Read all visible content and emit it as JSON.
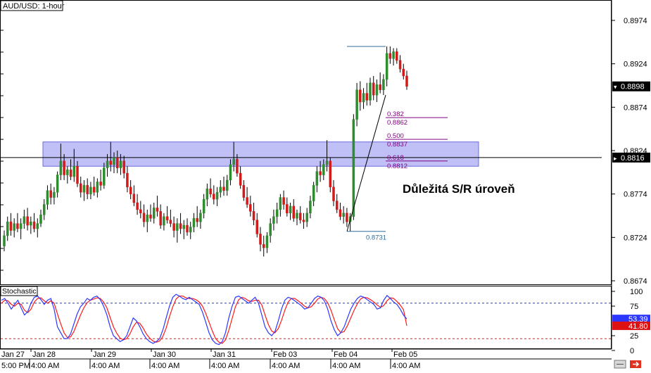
{
  "window": {
    "title": "AUD/USD: 1-hour",
    "indicator_label": "Stochastic",
    "annotation": "Důležitá S/R úroveň"
  },
  "colors": {
    "bull": "#2e8b2e",
    "bear": "#d11a1a",
    "zone": "#8c8cf0",
    "fib": "#800080",
    "swing": "#2f6b9a",
    "k_line": "#2b36ff",
    "d_line": "#ff1a1a",
    "ob": "#1f3fbf",
    "os": "#e02020"
  },
  "chart_data": [
    {
      "type": "candlestick",
      "title": "AUD/USD: 1-hour",
      "ylim": [
        0.8654,
        0.9
      ],
      "y_ticks": [
        "0.8974",
        "0.8924",
        "0.8874",
        "0.8824",
        "0.8774",
        "0.8724",
        "0.8674"
      ],
      "x_date_labels": [
        "Jan 27",
        "Jan 28",
        "Jan 29",
        "Jan 30",
        "Jan 31",
        "Feb 03",
        "Feb 04",
        "Feb 05"
      ],
      "x_time_labels": [
        "5:00 PM",
        "4:00 AM",
        "4:00 AM",
        "4:00 AM",
        "4:00 AM",
        "4:00 AM",
        "4:00 AM",
        "4:00 AM"
      ],
      "current_price": "0.8898",
      "hline_price": "0.8816",
      "support_resistance_zone": [
        0.8806,
        0.8834
      ],
      "fibonacci": {
        "swing_low": "0.8731",
        "swing_high": 0.8944,
        "levels": [
          {
            "ratio": "0.382",
            "price": "0.8862"
          },
          {
            "ratio": "0.500",
            "price": "0.8837"
          },
          {
            "ratio": "0.618",
            "price": "0.8812"
          }
        ]
      },
      "ohlc": [
        {
          "o": 0.8714,
          "h": 0.8732,
          "l": 0.8708,
          "c": 0.8726
        },
        {
          "o": 0.8726,
          "h": 0.8748,
          "l": 0.872,
          "c": 0.8742
        },
        {
          "o": 0.8742,
          "h": 0.8752,
          "l": 0.8726,
          "c": 0.8732
        },
        {
          "o": 0.8732,
          "h": 0.8746,
          "l": 0.8724,
          "c": 0.874
        },
        {
          "o": 0.874,
          "h": 0.8752,
          "l": 0.873,
          "c": 0.8734
        },
        {
          "o": 0.8734,
          "h": 0.8746,
          "l": 0.8722,
          "c": 0.874
        },
        {
          "o": 0.874,
          "h": 0.8756,
          "l": 0.8734,
          "c": 0.8748
        },
        {
          "o": 0.8748,
          "h": 0.8758,
          "l": 0.8732,
          "c": 0.8738
        },
        {
          "o": 0.8738,
          "h": 0.8748,
          "l": 0.8728,
          "c": 0.8742
        },
        {
          "o": 0.8742,
          "h": 0.8752,
          "l": 0.873,
          "c": 0.8734
        },
        {
          "o": 0.8734,
          "h": 0.8746,
          "l": 0.8724,
          "c": 0.874
        },
        {
          "o": 0.874,
          "h": 0.8756,
          "l": 0.8736,
          "c": 0.875
        },
        {
          "o": 0.875,
          "h": 0.8768,
          "l": 0.8744,
          "c": 0.8762
        },
        {
          "o": 0.8762,
          "h": 0.8784,
          "l": 0.8756,
          "c": 0.8778
        },
        {
          "o": 0.8778,
          "h": 0.8786,
          "l": 0.8762,
          "c": 0.877
        },
        {
          "o": 0.877,
          "h": 0.8782,
          "l": 0.8762,
          "c": 0.8776
        },
        {
          "o": 0.8776,
          "h": 0.88,
          "l": 0.877,
          "c": 0.8796
        },
        {
          "o": 0.8796,
          "h": 0.8832,
          "l": 0.879,
          "c": 0.8812
        },
        {
          "o": 0.8812,
          "h": 0.882,
          "l": 0.879,
          "c": 0.8796
        },
        {
          "o": 0.8796,
          "h": 0.8806,
          "l": 0.8786,
          "c": 0.8802
        },
        {
          "o": 0.8802,
          "h": 0.8814,
          "l": 0.879,
          "c": 0.8794
        },
        {
          "o": 0.8794,
          "h": 0.8826,
          "l": 0.8788,
          "c": 0.8806
        },
        {
          "o": 0.8806,
          "h": 0.8812,
          "l": 0.8782,
          "c": 0.8786
        },
        {
          "o": 0.8786,
          "h": 0.8794,
          "l": 0.877,
          "c": 0.8776
        },
        {
          "o": 0.8776,
          "h": 0.879,
          "l": 0.8766,
          "c": 0.8784
        },
        {
          "o": 0.8784,
          "h": 0.8792,
          "l": 0.8768,
          "c": 0.8774
        },
        {
          "o": 0.8774,
          "h": 0.8788,
          "l": 0.8768,
          "c": 0.8782
        },
        {
          "o": 0.8782,
          "h": 0.8794,
          "l": 0.8772,
          "c": 0.8776
        },
        {
          "o": 0.8776,
          "h": 0.8792,
          "l": 0.877,
          "c": 0.8788
        },
        {
          "o": 0.8788,
          "h": 0.8802,
          "l": 0.8778,
          "c": 0.8784
        },
        {
          "o": 0.8784,
          "h": 0.881,
          "l": 0.878,
          "c": 0.8804
        },
        {
          "o": 0.8804,
          "h": 0.882,
          "l": 0.8794,
          "c": 0.8812
        },
        {
          "o": 0.8812,
          "h": 0.8834,
          "l": 0.88,
          "c": 0.8808
        },
        {
          "o": 0.8808,
          "h": 0.8822,
          "l": 0.8798,
          "c": 0.8816
        },
        {
          "o": 0.8816,
          "h": 0.8824,
          "l": 0.8798,
          "c": 0.8804
        },
        {
          "o": 0.8804,
          "h": 0.882,
          "l": 0.8796,
          "c": 0.8812
        },
        {
          "o": 0.8812,
          "h": 0.8818,
          "l": 0.8792,
          "c": 0.8798
        },
        {
          "o": 0.8798,
          "h": 0.8806,
          "l": 0.8776,
          "c": 0.8782
        },
        {
          "o": 0.8782,
          "h": 0.879,
          "l": 0.8768,
          "c": 0.8774
        },
        {
          "o": 0.8774,
          "h": 0.8784,
          "l": 0.876,
          "c": 0.8764
        },
        {
          "o": 0.8764,
          "h": 0.8774,
          "l": 0.875,
          "c": 0.8756
        },
        {
          "o": 0.8756,
          "h": 0.8766,
          "l": 0.8746,
          "c": 0.8752
        },
        {
          "o": 0.8752,
          "h": 0.8762,
          "l": 0.8736,
          "c": 0.8742
        },
        {
          "o": 0.8742,
          "h": 0.8756,
          "l": 0.873,
          "c": 0.875
        },
        {
          "o": 0.875,
          "h": 0.8762,
          "l": 0.8742,
          "c": 0.8746
        },
        {
          "o": 0.8746,
          "h": 0.8764,
          "l": 0.874,
          "c": 0.8758
        },
        {
          "o": 0.8758,
          "h": 0.8772,
          "l": 0.8748,
          "c": 0.8754
        },
        {
          "o": 0.8754,
          "h": 0.8762,
          "l": 0.8734,
          "c": 0.8738
        },
        {
          "o": 0.8738,
          "h": 0.8752,
          "l": 0.8732,
          "c": 0.8748
        },
        {
          "o": 0.8748,
          "h": 0.876,
          "l": 0.874,
          "c": 0.8744
        },
        {
          "o": 0.8744,
          "h": 0.8756,
          "l": 0.8736,
          "c": 0.874
        },
        {
          "o": 0.874,
          "h": 0.8748,
          "l": 0.8724,
          "c": 0.8732
        },
        {
          "o": 0.8732,
          "h": 0.8746,
          "l": 0.8718,
          "c": 0.874
        },
        {
          "o": 0.874,
          "h": 0.8752,
          "l": 0.8728,
          "c": 0.8734
        },
        {
          "o": 0.8734,
          "h": 0.8744,
          "l": 0.8722,
          "c": 0.8738
        },
        {
          "o": 0.8738,
          "h": 0.8746,
          "l": 0.8726,
          "c": 0.873
        },
        {
          "o": 0.873,
          "h": 0.8742,
          "l": 0.8722,
          "c": 0.8736
        },
        {
          "o": 0.8736,
          "h": 0.8752,
          "l": 0.873,
          "c": 0.8746
        },
        {
          "o": 0.8746,
          "h": 0.876,
          "l": 0.8736,
          "c": 0.8742
        },
        {
          "o": 0.8742,
          "h": 0.8756,
          "l": 0.8734,
          "c": 0.8752
        },
        {
          "o": 0.8752,
          "h": 0.8774,
          "l": 0.8746,
          "c": 0.8768
        },
        {
          "o": 0.8768,
          "h": 0.8786,
          "l": 0.876,
          "c": 0.878
        },
        {
          "o": 0.878,
          "h": 0.8792,
          "l": 0.877,
          "c": 0.8774
        },
        {
          "o": 0.8774,
          "h": 0.8784,
          "l": 0.8762,
          "c": 0.8768
        },
        {
          "o": 0.8768,
          "h": 0.8782,
          "l": 0.876,
          "c": 0.8776
        },
        {
          "o": 0.8776,
          "h": 0.879,
          "l": 0.877,
          "c": 0.8782
        },
        {
          "o": 0.8782,
          "h": 0.8794,
          "l": 0.8772,
          "c": 0.8778
        },
        {
          "o": 0.8778,
          "h": 0.8796,
          "l": 0.8772,
          "c": 0.879
        },
        {
          "o": 0.879,
          "h": 0.8814,
          "l": 0.8784,
          "c": 0.8808
        },
        {
          "o": 0.8808,
          "h": 0.8834,
          "l": 0.88,
          "c": 0.8814
        },
        {
          "o": 0.8814,
          "h": 0.882,
          "l": 0.8794,
          "c": 0.8798
        },
        {
          "o": 0.8798,
          "h": 0.8806,
          "l": 0.878,
          "c": 0.8784
        },
        {
          "o": 0.8784,
          "h": 0.879,
          "l": 0.8766,
          "c": 0.877
        },
        {
          "o": 0.877,
          "h": 0.8782,
          "l": 0.8758,
          "c": 0.8762
        },
        {
          "o": 0.8762,
          "h": 0.8772,
          "l": 0.8748,
          "c": 0.8754
        },
        {
          "o": 0.8754,
          "h": 0.8764,
          "l": 0.8738,
          "c": 0.8744
        },
        {
          "o": 0.8744,
          "h": 0.8752,
          "l": 0.8724,
          "c": 0.8728
        },
        {
          "o": 0.8728,
          "h": 0.8736,
          "l": 0.8708,
          "c": 0.8716
        },
        {
          "o": 0.8716,
          "h": 0.8726,
          "l": 0.8702,
          "c": 0.8712
        },
        {
          "o": 0.8712,
          "h": 0.873,
          "l": 0.8706,
          "c": 0.8726
        },
        {
          "o": 0.8726,
          "h": 0.8746,
          "l": 0.8718,
          "c": 0.874
        },
        {
          "o": 0.874,
          "h": 0.8756,
          "l": 0.8732,
          "c": 0.8748
        },
        {
          "o": 0.8748,
          "h": 0.8764,
          "l": 0.874,
          "c": 0.8756
        },
        {
          "o": 0.8756,
          "h": 0.8774,
          "l": 0.8748,
          "c": 0.877
        },
        {
          "o": 0.877,
          "h": 0.8778,
          "l": 0.8756,
          "c": 0.8762
        },
        {
          "o": 0.8762,
          "h": 0.877,
          "l": 0.8748,
          "c": 0.8752
        },
        {
          "o": 0.8752,
          "h": 0.8764,
          "l": 0.8744,
          "c": 0.876
        },
        {
          "o": 0.876,
          "h": 0.8768,
          "l": 0.8742,
          "c": 0.8746
        },
        {
          "o": 0.8746,
          "h": 0.8756,
          "l": 0.8738,
          "c": 0.8752
        },
        {
          "o": 0.8752,
          "h": 0.876,
          "l": 0.874,
          "c": 0.8744
        },
        {
          "o": 0.8744,
          "h": 0.8752,
          "l": 0.8734,
          "c": 0.8742
        },
        {
          "o": 0.8742,
          "h": 0.8758,
          "l": 0.8736,
          "c": 0.8752
        },
        {
          "o": 0.8752,
          "h": 0.8772,
          "l": 0.8746,
          "c": 0.8766
        },
        {
          "o": 0.8766,
          "h": 0.8788,
          "l": 0.876,
          "c": 0.8784
        },
        {
          "o": 0.8784,
          "h": 0.8806,
          "l": 0.8776,
          "c": 0.88
        },
        {
          "o": 0.88,
          "h": 0.8812,
          "l": 0.8788,
          "c": 0.8796
        },
        {
          "o": 0.8796,
          "h": 0.8814,
          "l": 0.879,
          "c": 0.8808
        },
        {
          "o": 0.8808,
          "h": 0.8836,
          "l": 0.88,
          "c": 0.8812
        },
        {
          "o": 0.8812,
          "h": 0.8816,
          "l": 0.8776,
          "c": 0.8782
        },
        {
          "o": 0.8782,
          "h": 0.879,
          "l": 0.876,
          "c": 0.8766
        },
        {
          "o": 0.8766,
          "h": 0.8774,
          "l": 0.8752,
          "c": 0.8756
        },
        {
          "o": 0.8756,
          "h": 0.8764,
          "l": 0.8744,
          "c": 0.8748
        },
        {
          "o": 0.8748,
          "h": 0.876,
          "l": 0.874,
          "c": 0.8752
        },
        {
          "o": 0.8752,
          "h": 0.8758,
          "l": 0.8736,
          "c": 0.8742
        },
        {
          "o": 0.8742,
          "h": 0.8752,
          "l": 0.8731,
          "c": 0.8748
        },
        {
          "o": 0.8748,
          "h": 0.8866,
          "l": 0.8744,
          "c": 0.886
        },
        {
          "o": 0.886,
          "h": 0.8902,
          "l": 0.8852,
          "c": 0.8894
        },
        {
          "o": 0.8894,
          "h": 0.8904,
          "l": 0.887,
          "c": 0.888
        },
        {
          "o": 0.888,
          "h": 0.8896,
          "l": 0.8872,
          "c": 0.889
        },
        {
          "o": 0.889,
          "h": 0.8902,
          "l": 0.8876,
          "c": 0.8882
        },
        {
          "o": 0.8882,
          "h": 0.8908,
          "l": 0.8876,
          "c": 0.8902
        },
        {
          "o": 0.8902,
          "h": 0.891,
          "l": 0.8882,
          "c": 0.8888
        },
        {
          "o": 0.8888,
          "h": 0.8906,
          "l": 0.888,
          "c": 0.89
        },
        {
          "o": 0.89,
          "h": 0.8914,
          "l": 0.889,
          "c": 0.8894
        },
        {
          "o": 0.8894,
          "h": 0.8912,
          "l": 0.8888,
          "c": 0.8906
        },
        {
          "o": 0.8906,
          "h": 0.8944,
          "l": 0.8898,
          "c": 0.8936
        },
        {
          "o": 0.8936,
          "h": 0.8944,
          "l": 0.8924,
          "c": 0.893
        },
        {
          "o": 0.893,
          "h": 0.8942,
          "l": 0.8922,
          "c": 0.8938
        },
        {
          "o": 0.8938,
          "h": 0.8942,
          "l": 0.8924,
          "c": 0.8928
        },
        {
          "o": 0.8928,
          "h": 0.8934,
          "l": 0.8914,
          "c": 0.8918
        },
        {
          "o": 0.8918,
          "h": 0.8924,
          "l": 0.8906,
          "c": 0.891
        },
        {
          "o": 0.891,
          "h": 0.8916,
          "l": 0.8894,
          "c": 0.8898
        }
      ]
    },
    {
      "type": "line",
      "title": "Stochastic",
      "ylim": [
        0,
        100
      ],
      "y_ticks": [
        "100",
        "75",
        "25",
        "0"
      ],
      "overbought": 80,
      "oversold": 20,
      "k_value": "53.39",
      "d_value": "41.80",
      "series": [
        {
          "values": [
            85,
            88,
            80,
            70,
            78,
            85,
            72,
            60,
            66,
            80,
            90,
            92,
            86,
            78,
            85,
            88,
            70,
            40,
            30,
            20,
            20,
            28,
            45,
            62,
            74,
            80,
            88,
            85,
            90,
            92,
            86,
            75,
            60,
            40,
            25,
            20,
            15,
            18,
            25,
            40,
            55,
            50,
            40,
            28,
            20,
            15,
            12,
            15,
            20,
            35,
            55,
            75,
            90,
            95,
            92,
            88,
            86,
            90,
            86,
            82,
            78,
            65,
            48,
            30,
            18,
            12,
            10,
            15,
            30,
            55,
            75,
            90,
            92,
            88,
            84,
            80,
            85,
            90,
            80,
            60,
            40,
            30,
            25,
            32,
            50,
            70,
            85,
            90,
            88,
            84,
            80,
            76,
            70,
            72,
            80,
            88,
            92,
            90,
            84,
            70,
            50,
            35,
            25,
            30,
            40,
            55,
            70,
            80,
            88,
            92,
            90,
            86,
            82,
            78,
            70,
            72,
            85,
            93,
            88,
            82,
            78,
            70,
            60,
            53.39
          ]
        },
        {
          "values": [
            80,
            85,
            84,
            78,
            75,
            80,
            78,
            68,
            64,
            70,
            82,
            88,
            89,
            84,
            80,
            84,
            80,
            62,
            45,
            30,
            22,
            23,
            32,
            46,
            60,
            72,
            81,
            85,
            87,
            89,
            88,
            82,
            72,
            56,
            40,
            29,
            21,
            18,
            20,
            28,
            40,
            48,
            46,
            38,
            28,
            21,
            16,
            14,
            16,
            24,
            38,
            57,
            74,
            87,
            92,
            92,
            89,
            88,
            88,
            86,
            82,
            75,
            63,
            48,
            33,
            20,
            14,
            12,
            18,
            34,
            54,
            74,
            86,
            90,
            88,
            84,
            83,
            85,
            85,
            77,
            60,
            44,
            33,
            30,
            37,
            51,
            68,
            82,
            88,
            88,
            84,
            80,
            75,
            72,
            74,
            80,
            87,
            90,
            88,
            81,
            68,
            52,
            37,
            30,
            32,
            42,
            55,
            68,
            79,
            87,
            90,
            89,
            86,
            82,
            77,
            73,
            76,
            84,
            89,
            88,
            83,
            77,
            69,
            41.8
          ]
        }
      ]
    }
  ]
}
